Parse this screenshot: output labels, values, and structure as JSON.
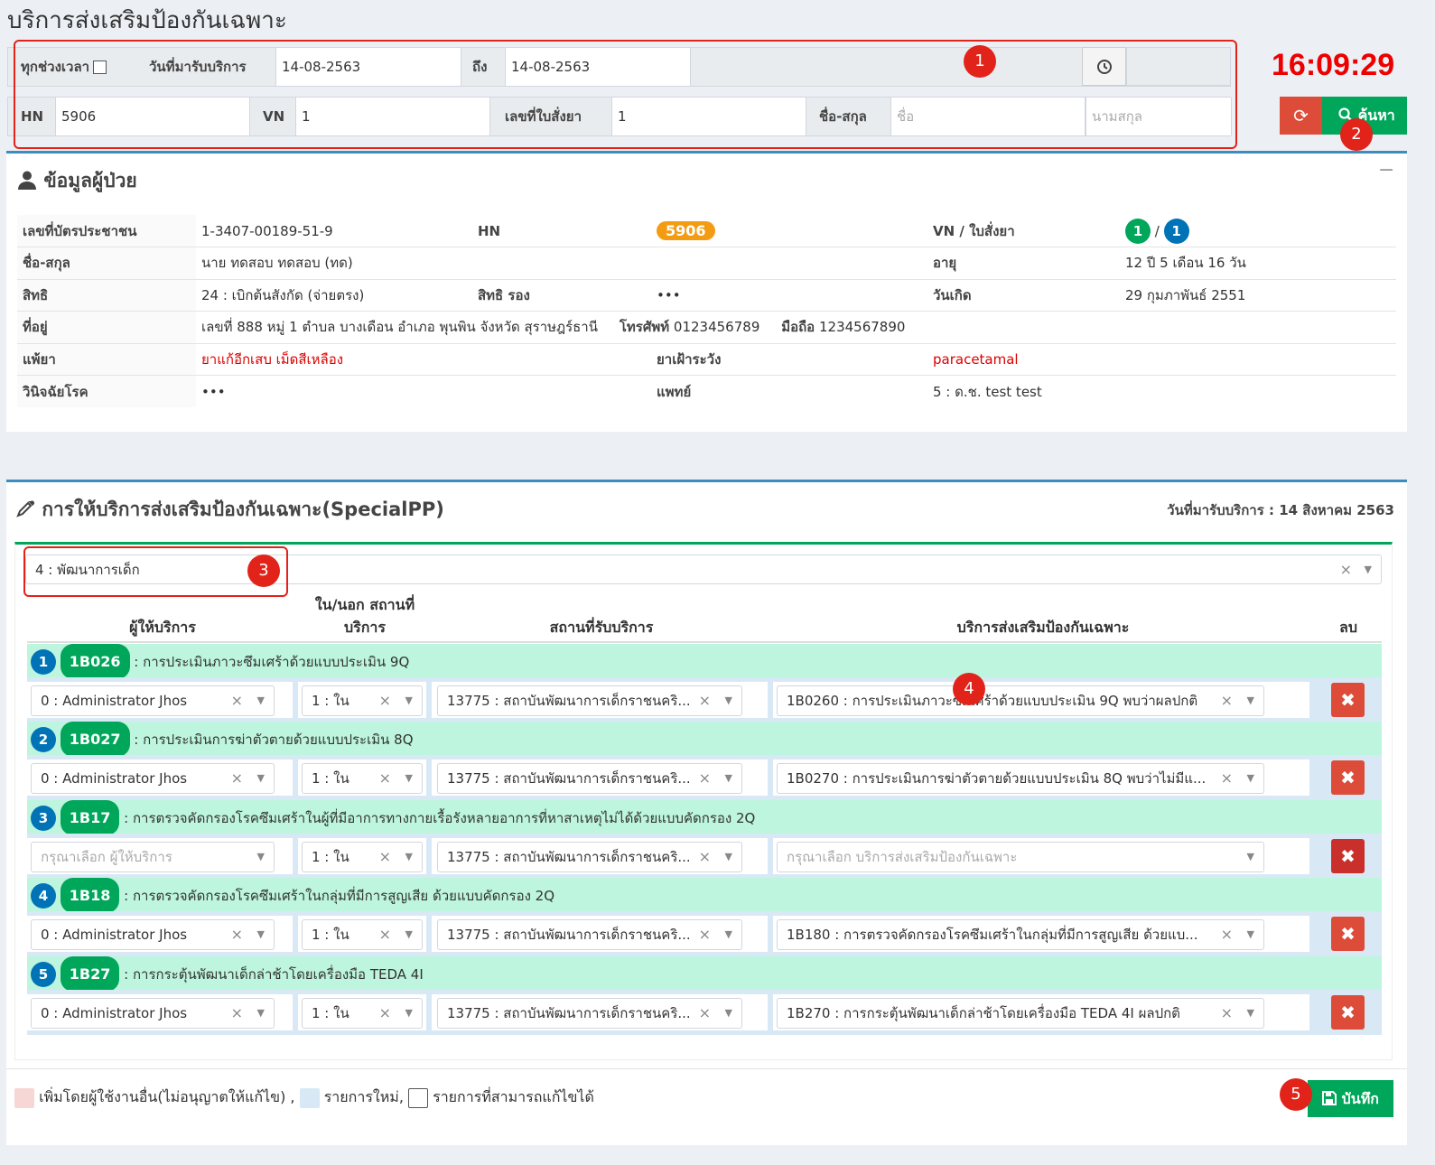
{
  "page_title": "บริการส่งเสริมป้องกันเฉพาะ",
  "clock": "16:09:29",
  "filter": {
    "all_time_label": "ทุกช่วงเวลา",
    "service_date_label": "วันที่มารับบริการ",
    "date_from": "14-08-2563",
    "to_label": "ถึง",
    "date_to": "14-08-2563",
    "hn_label": "HN",
    "hn_value": "5906",
    "vn_label": "VN",
    "vn_value": "1",
    "order_label": "เลขที่ใบสั่งยา",
    "order_value": "1",
    "name_label": "ชื่อ-สกุล",
    "first_name_placeholder": "ชื่อ",
    "last_name_placeholder": "นามสกุล",
    "search_label": "ค้นหา"
  },
  "markers": [
    "1",
    "2",
    "3",
    "4",
    "5"
  ],
  "patient": {
    "title": "ข้อมูลผู้ป่วย",
    "collapse": "−",
    "id_card_label": "เลขที่บัตรประชาชน",
    "id_card": "1-3407-00189-51-9",
    "hn_label": "HN",
    "hn": "5906",
    "vn_label": "VN / ใบสั่งยา",
    "vn": "1",
    "slash": "/",
    "order_no": "1",
    "name_label": "ชื่อ-สกุล",
    "name": "นาย ทดสอบ ทดสอบ (ทด)",
    "age_label": "อายุ",
    "age": "12 ปี 5 เดือน 16 วัน",
    "right_label": "สิทธิ",
    "right": "24 : เบิกต้นสังกัด (จ่ายตรง)",
    "right2_label": "สิทธิ รอง",
    "right2": "•••",
    "birth_label": "วันเกิด",
    "birth": "29 กุมภาพันธ์ 2551",
    "address_label": "ที่อยู่",
    "address": "เลขที่ 888 หมู่ 1 ตำบล บางเดือน อำเภอ พุนพิน จังหวัด สุราษฎร์ธานี",
    "phone_label": "โทรศัพท์",
    "phone": "0123456789",
    "mobile_label": "มือถือ",
    "mobile": "1234567890",
    "allergy_label": "แพ้ยา",
    "allergy": "ยาแก้อีกเสบ เม็ดสีเหลือง",
    "watch_label": "ยาเฝ้าระวัง",
    "watch": "paracetamal",
    "diag_label": "วินิจฉัยโรค",
    "diag": "•••",
    "doctor_label": "แพทย์",
    "doctor": "5 : ด.ช. test test"
  },
  "service": {
    "title": "การให้บริการส่งเสริมป้องกันเฉพาะ(SpecialPP)",
    "date_text": "วันที่มารับบริการ : 14 สิงหาคม 2563",
    "group_select": "4 : พัฒนาการเด็ก",
    "col_provider": "ผู้ให้บริการ",
    "col_inout_1": "ใน/นอก สถานที่",
    "col_inout_2": "บริการ",
    "col_place": "สถานที่รับบริการ",
    "col_service": "บริการส่งเสริมป้องกันเฉพาะ",
    "col_delete": "ลบ",
    "rows": [
      {
        "num": "1",
        "code": "1B026",
        "desc": ": การประเมินภาวะซึมเศร้าด้วยแบบประเมิน 9Q",
        "provider": "0 : Administrator Jhos",
        "inout": "1 : ใน",
        "place": "13775 : สถาบันพัฒนาการเด็กราชนคริ...",
        "svc": "1B0260 : การประเมินภาวะซึมเศร้าด้วยแบบประเมิน 9Q พบว่าผลปกติ"
      },
      {
        "num": "2",
        "code": "1B027",
        "desc": ": การประเมินการฆ่าตัวตายด้วยแบบประเมิน 8Q",
        "provider": "0 : Administrator Jhos",
        "inout": "1 : ใน",
        "place": "13775 : สถาบันพัฒนาการเด็กราชนคริ...",
        "svc": "1B0270 : การประเมินการฆ่าตัวตายด้วยแบบประเมิน 8Q พบว่าไม่มีแ..."
      },
      {
        "num": "3",
        "code": "1B17",
        "desc": ": การตรวจคัดกรองโรคซึมเศร้าในผู้ที่มีอาการทางกายเรื้อรังหลายอาการที่หาสาเหตุไม่ได้ด้วยแบบคัดกรอง 2Q",
        "provider": "กรุณาเลือก ผู้ให้บริการ",
        "inout": "1 : ใน",
        "place": "13775 : สถาบันพัฒนาการเด็กราชนคริ...",
        "svc": "กรุณาเลือก บริการส่งเสริมป้องกันเฉพาะ"
      },
      {
        "num": "4",
        "code": "1B18",
        "desc": ": การตรวจคัดกรองโรคซึมเศร้าในกลุ่มที่มีการสูญเสีย ด้วยแบบคัดกรอง 2Q",
        "provider": "0 : Administrator Jhos",
        "inout": "1 : ใน",
        "place": "13775 : สถาบันพัฒนาการเด็กราชนคริ...",
        "svc": "1B180 : การตรวจคัดกรองโรคซึมเศร้าในกลุ่มที่มีการสูญเสีย ด้วยแบ..."
      },
      {
        "num": "5",
        "code": "1B27",
        "desc": ": การกระตุ้นพัฒนาเด็กล่าช้าโดยเครื่องมือ TEDA 4I",
        "provider": "0 : Administrator Jhos",
        "inout": "1 : ใน",
        "place": "13775 : สถาบันพัฒนาการเด็กราชนคริ...",
        "svc": "1B270 : การกระตุ้นพัฒนาเด็กล่าช้าโดยเครื่องมือ TEDA 4I ผลปกติ"
      }
    ],
    "legend_other": "เพิ่มโดยผู้ใช้งานอื่น(ไม่อนุญาตให้แก้ไข) ,",
    "legend_new": "รายการใหม่,",
    "legend_editable": "รายการที่สามารถแก้ไขได้",
    "save_label": "บันทึก"
  },
  "colors": {
    "accent": "#3c8dbc",
    "success": "#00a65a",
    "danger": "#dd4b39",
    "clock": "#e00000",
    "group_row": "#bdf5de",
    "data_row": "#d8e9f5"
  }
}
